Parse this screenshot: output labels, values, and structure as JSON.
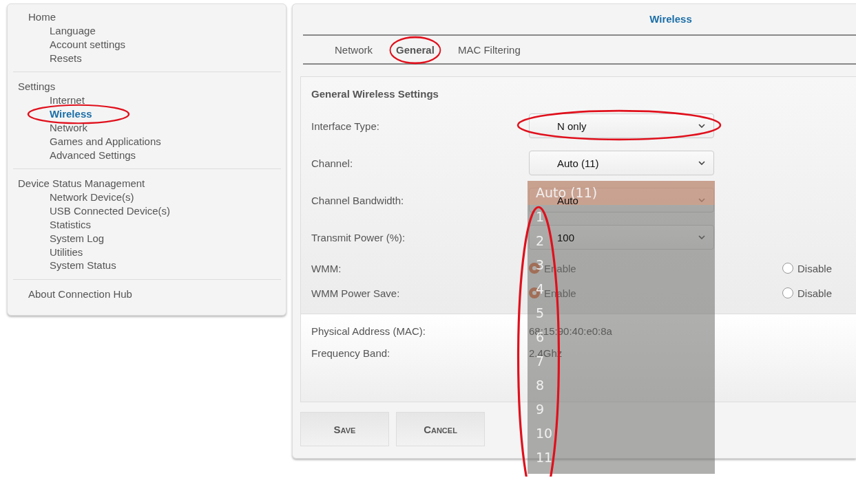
{
  "sidebar": {
    "groups": [
      {
        "kind": "page",
        "label": "Home",
        "items": [
          {
            "label": "Language",
            "selected": false,
            "circled": false
          },
          {
            "label": "Account settings",
            "selected": false,
            "circled": false
          },
          {
            "label": "Resets",
            "selected": false,
            "circled": false
          }
        ]
      },
      {
        "kind": "section",
        "label": "Settings",
        "items": [
          {
            "label": "Internet",
            "selected": false,
            "circled": false
          },
          {
            "label": "Wireless",
            "selected": true,
            "circled": true
          },
          {
            "label": "Network",
            "selected": false,
            "circled": false
          },
          {
            "label": "Games and Applications",
            "selected": false,
            "circled": false
          },
          {
            "label": "Advanced Settings",
            "selected": false,
            "circled": false
          }
        ]
      },
      {
        "kind": "section",
        "label": "Device Status Management",
        "items": [
          {
            "label": "Network Device(s)",
            "selected": false,
            "circled": false
          },
          {
            "label": "USB Connected Device(s)",
            "selected": false,
            "circled": false
          },
          {
            "label": "Statistics",
            "selected": false,
            "circled": false
          },
          {
            "label": "System Log",
            "selected": false,
            "circled": false
          },
          {
            "label": "Utilities",
            "selected": false,
            "circled": false
          },
          {
            "label": "System Status",
            "selected": false,
            "circled": false
          }
        ]
      },
      {
        "kind": "page",
        "label": "About Connection Hub"
      }
    ]
  },
  "main": {
    "title": "Wireless",
    "tabs": [
      {
        "label": "Network",
        "selected": false,
        "circled": false
      },
      {
        "label": "General",
        "selected": true,
        "circled": true
      },
      {
        "label": "MAC Filtering",
        "selected": false,
        "circled": false
      }
    ],
    "section_title": "General Wireless Settings",
    "fields": [
      {
        "kind": "select",
        "label": "Interface Type:",
        "value": "N only",
        "circled": true
      },
      {
        "kind": "select",
        "label": "Channel:",
        "value": "Auto (11)",
        "circled": false
      },
      {
        "kind": "select",
        "label": "Channel Bandwidth:",
        "value": "Auto",
        "circled": false
      },
      {
        "kind": "select",
        "label": "Transmit Power (%):",
        "value": "100",
        "circled": false
      },
      {
        "kind": "radio",
        "label": "WMM:",
        "options": [
          {
            "label": "Enable",
            "selected": true
          },
          {
            "label": "Disable",
            "selected": false
          }
        ]
      },
      {
        "kind": "radio",
        "label": "WMM Power Save:",
        "options": [
          {
            "label": "Enable",
            "selected": true
          },
          {
            "label": "Disable",
            "selected": false
          }
        ]
      }
    ],
    "info": [
      {
        "label": "Physical Address (MAC):",
        "value": "68:15:90:40:e0:8a"
      },
      {
        "label": "Frequency Band:",
        "value": "2.4Ghz"
      }
    ],
    "buttons": [
      "Save",
      "Cancel"
    ],
    "channel_dropdown": {
      "circled": true,
      "options": [
        {
          "label": "Auto (11)",
          "selected": true
        },
        {
          "label": "1",
          "selected": false
        },
        {
          "label": "2",
          "selected": false
        },
        {
          "label": "3",
          "selected": false
        },
        {
          "label": "4",
          "selected": false
        },
        {
          "label": "5",
          "selected": false
        },
        {
          "label": "6",
          "selected": false
        },
        {
          "label": "7",
          "selected": false
        },
        {
          "label": "8",
          "selected": false
        },
        {
          "label": "9",
          "selected": false
        },
        {
          "label": "10",
          "selected": false
        },
        {
          "label": "11",
          "selected": false
        }
      ]
    }
  }
}
